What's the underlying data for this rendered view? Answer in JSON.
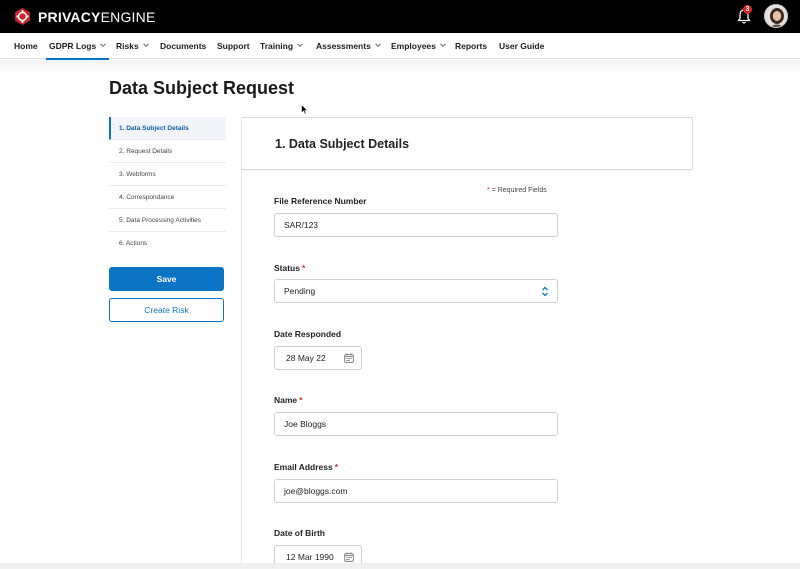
{
  "app": {
    "logo_bold": "PRIVACY",
    "logo_light": "ENGINE",
    "notification_count": "3",
    "colors": {
      "brand_red": "#c9252c",
      "accent_blue": "#0b74c4"
    }
  },
  "nav": {
    "items": [
      {
        "label": "Home",
        "has_chevron": false
      },
      {
        "label": "GDPR Logs",
        "has_chevron": true,
        "active": true
      },
      {
        "label": "Risks",
        "has_chevron": true
      },
      {
        "label": "Documents",
        "has_chevron": false
      },
      {
        "label": "Support",
        "has_chevron": false
      },
      {
        "label": "Training",
        "has_chevron": true
      },
      {
        "label": "Assessments",
        "has_chevron": true
      },
      {
        "label": "Employees",
        "has_chevron": true
      },
      {
        "label": "Reports",
        "has_chevron": false
      },
      {
        "label": "User Guide",
        "has_chevron": false
      }
    ]
  },
  "page": {
    "title": "Data Subject Request"
  },
  "steps": [
    {
      "label": "1. Data Subject Details",
      "active": true
    },
    {
      "label": "2. Request Details"
    },
    {
      "label": "3. Webforms"
    },
    {
      "label": "4. Correspondance"
    },
    {
      "label": "5. Data Processing Activities"
    },
    {
      "label": "6. Actions"
    }
  ],
  "actions": {
    "save_label": "Save",
    "create_risk_label": "Create Risk"
  },
  "form": {
    "section_title": "1.  Data Subject Details",
    "required_note_star": "*",
    "required_note": "= Required Fields",
    "fields": {
      "file_ref": {
        "label": "File Reference Number",
        "value": "SAR/123"
      },
      "status": {
        "label": "Status",
        "required": true,
        "value": "Pending"
      },
      "date_responded": {
        "label": "Date Responded",
        "value": "28 May 22"
      },
      "name": {
        "label": "Name",
        "required": true,
        "value": "Joe Bloggs"
      },
      "email": {
        "label": "Email Address",
        "required": true,
        "value": "joe@bloggs.com"
      },
      "dob": {
        "label": "Date of Birth",
        "value": "12 Mar 1990"
      }
    }
  }
}
